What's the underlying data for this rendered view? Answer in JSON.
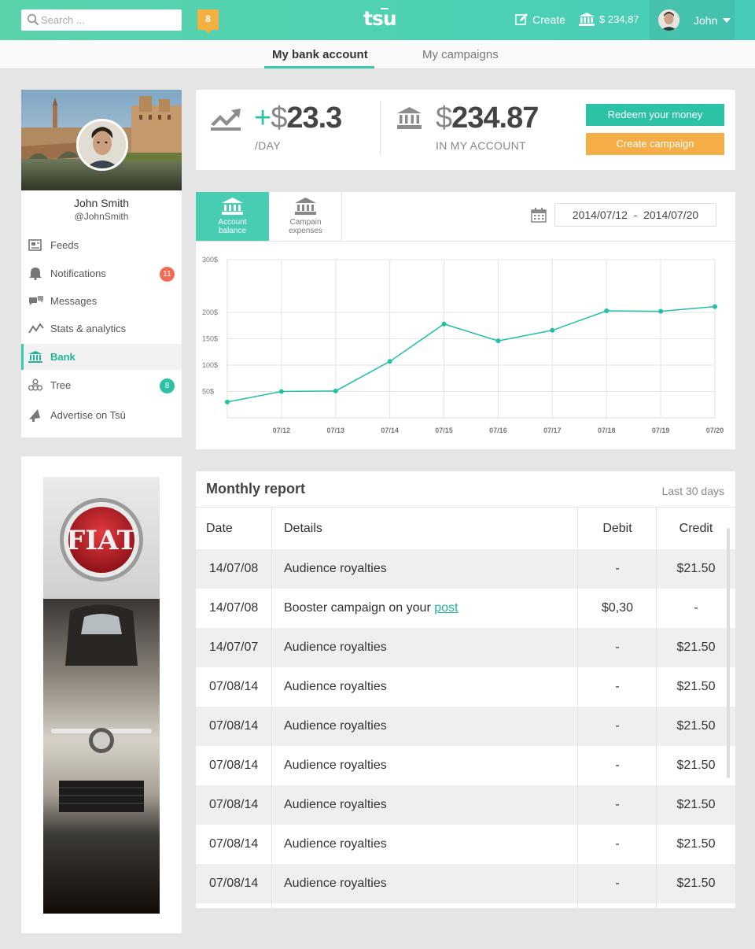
{
  "topbar": {
    "search_placeholder": "Search ...",
    "notification_count": "8",
    "logo": "tsu",
    "create_label": "Create",
    "balance_label": "$ 234,87",
    "user_name": "John"
  },
  "subnav": {
    "tabs": [
      {
        "label": "My bank account",
        "active": true
      },
      {
        "label": "My campaigns",
        "active": false
      }
    ]
  },
  "profile": {
    "name": "John Smith",
    "handle": "@JohnSmith",
    "menu": [
      {
        "label": "Feeds",
        "icon": "feeds-icon"
      },
      {
        "label": "Notifications",
        "icon": "bell-icon",
        "badge": "11",
        "badge_color": "#f26b55"
      },
      {
        "label": "Messages",
        "icon": "messages-icon"
      },
      {
        "label": "Stats & analytics",
        "icon": "stats-icon"
      },
      {
        "label": "Bank",
        "icon": "bank-icon",
        "active": true
      },
      {
        "label": "Tree",
        "icon": "tree-icon",
        "badge": "8",
        "badge_color": "#2cc2a6"
      },
      {
        "label": "Advertise on Tsū",
        "icon": "megaphone-icon"
      }
    ]
  },
  "ad": {
    "brand": "FIAT"
  },
  "stats": {
    "daily_prefix": "+",
    "daily_currency": "$",
    "daily_value": "23.3",
    "daily_label": "/DAY",
    "account_currency": "$",
    "account_value": "234.87",
    "account_label": "IN MY ACCOUNT",
    "redeem_button": "Redeem your money",
    "create_campaign_button": "Create campaign"
  },
  "chart_panel": {
    "tabs": [
      {
        "label_line1": "Account",
        "label_line2": "balance",
        "active": true
      },
      {
        "label_line1": "Campain",
        "label_line2": "expenses",
        "active": false
      }
    ],
    "date_from": "2014/07/12",
    "date_sep": "-",
    "date_to": "2014/07/20"
  },
  "chart_data": {
    "type": "line",
    "title": "",
    "xlabel": "",
    "ylabel": "",
    "x": [
      "",
      "07/12",
      "07/13",
      "07/14",
      "07/15",
      "07/16",
      "07/17",
      "07/18",
      "07/19",
      "07/20"
    ],
    "series": [
      {
        "values": [
          30,
          50,
          51,
          107,
          178,
          146,
          166,
          203,
          202,
          211
        ]
      }
    ],
    "ylim": [
      0,
      300
    ],
    "yticks": [
      50,
      100,
      150,
      200,
      300
    ],
    "ytick_labels": [
      "50$",
      "100$",
      "150$",
      "200$",
      "300$"
    ],
    "grid": true,
    "color": "#22c1a5"
  },
  "report": {
    "title": "Monthly report",
    "range": "Last 30 days",
    "columns": [
      "Date",
      "Details",
      "Debit",
      "Credit"
    ],
    "rows": [
      {
        "date": "14/07/08",
        "details": "Audience royalties",
        "debit": "-",
        "credit": "$21.50"
      },
      {
        "date": "14/07/08",
        "details": "Booster campaign on your ",
        "link": "post",
        "debit": "$0,30",
        "credit": "-"
      },
      {
        "date": "14/07/07",
        "details": "Audience royalties",
        "debit": "-",
        "credit": "$21.50"
      },
      {
        "date": "07/08/14",
        "details": "Audience royalties",
        "debit": "-",
        "credit": "$21.50"
      },
      {
        "date": "07/08/14",
        "details": "Audience royalties",
        "debit": "-",
        "credit": "$21.50"
      },
      {
        "date": "07/08/14",
        "details": "Audience royalties",
        "debit": "-",
        "credit": "$21.50"
      },
      {
        "date": "07/08/14",
        "details": "Audience royalties",
        "debit": "-",
        "credit": "$21.50"
      },
      {
        "date": "07/08/14",
        "details": "Audience royalties",
        "debit": "-",
        "credit": "$21.50"
      },
      {
        "date": "07/08/14",
        "details": "Audience royalties",
        "debit": "-",
        "credit": "$21.50"
      }
    ]
  }
}
